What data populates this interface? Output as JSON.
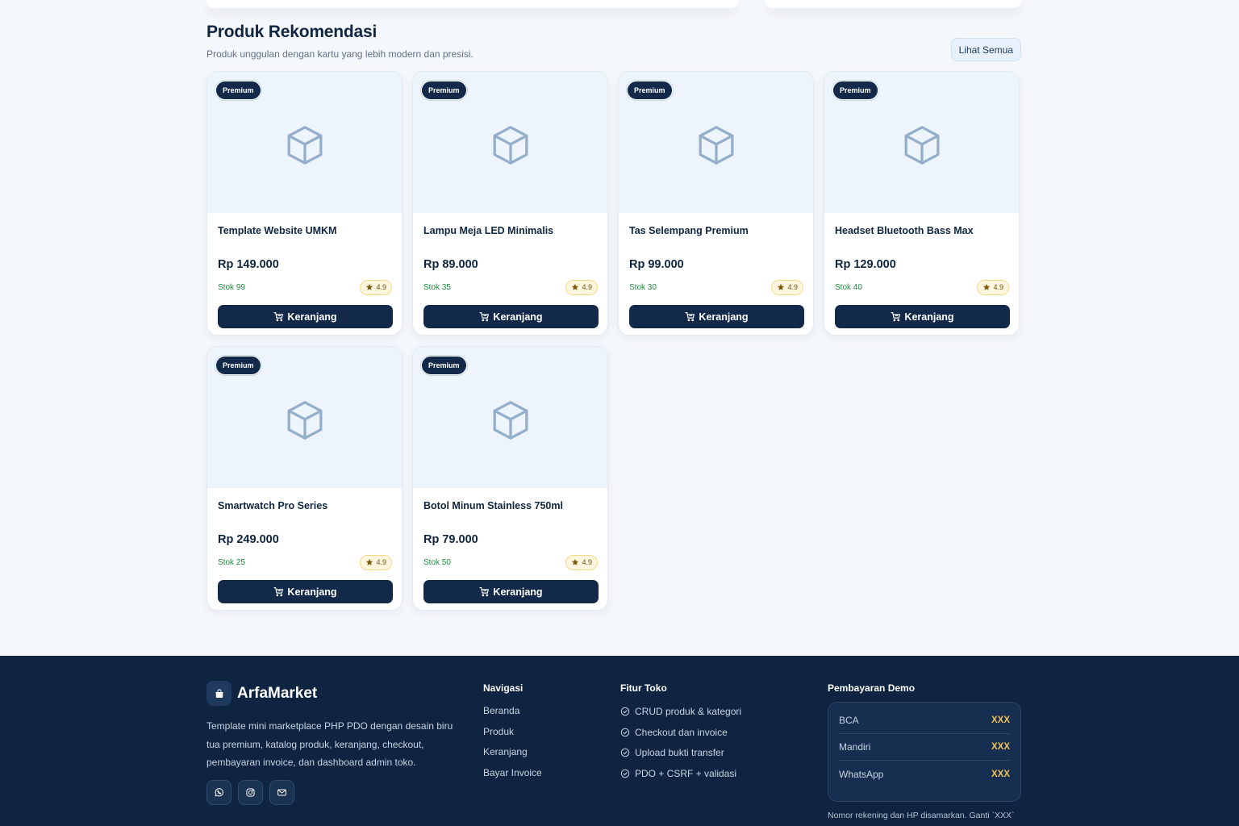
{
  "section": {
    "title": "Produk Rekomendasi",
    "subtitle": "Produk unggulan dengan kartu yang lebih modern dan presisi.",
    "see_all": "Lihat Semua"
  },
  "products": [
    {
      "badge": "Premium",
      "name": "Template Website UMKM",
      "price": "Rp 149.000",
      "stock": "Stok 99",
      "rating": "4.9",
      "button": "Keranjang"
    },
    {
      "badge": "Premium",
      "name": "Lampu Meja LED Minimalis",
      "price": "Rp 89.000",
      "stock": "Stok 35",
      "rating": "4.9",
      "button": "Keranjang"
    },
    {
      "badge": "Premium",
      "name": "Tas Selempang Premium",
      "price": "Rp 99.000",
      "stock": "Stok 30",
      "rating": "4.9",
      "button": "Keranjang"
    },
    {
      "badge": "Premium",
      "name": "Headset Bluetooth Bass Max",
      "price": "Rp 129.000",
      "stock": "Stok 40",
      "rating": "4.9",
      "button": "Keranjang"
    },
    {
      "badge": "Premium",
      "name": "Smartwatch Pro Series",
      "price": "Rp 249.000",
      "stock": "Stok 25",
      "rating": "4.9",
      "button": "Keranjang"
    },
    {
      "badge": "Premium",
      "name": "Botol Minum Stainless 750ml",
      "price": "Rp 79.000",
      "stock": "Stok 50",
      "rating": "4.9",
      "button": "Keranjang"
    }
  ],
  "footer": {
    "brand": "ArfaMarket",
    "description": "Template mini marketplace PHP PDO dengan desain biru tua premium, katalog produk, keranjang, checkout, pembayaran invoice, dan dashboard admin toko.",
    "socials": [
      "whatsapp-icon",
      "instagram-icon",
      "mail-icon"
    ],
    "nav_title": "Navigasi",
    "nav_items": [
      "Beranda",
      "Produk",
      "Keranjang",
      "Bayar Invoice"
    ],
    "features_title": "Fitur Toko",
    "features": [
      "CRUD produk & kategori",
      "Checkout dan invoice",
      "Upload bukti transfer",
      "PDO + CSRF + validasi"
    ],
    "payment_title": "Pembayaran Demo",
    "payments": [
      {
        "label": "BCA",
        "value": "XXX"
      },
      {
        "label": "Mandiri",
        "value": "XXX"
      },
      {
        "label": "WhatsApp",
        "value": "XXX"
      }
    ],
    "payment_note": "Nomor rekening dan HP disamarkan. Ganti `XXX`"
  },
  "colors": {
    "primary": "#12294a",
    "footer_bg": "#0e2440",
    "stock_green": "#1b8a3e",
    "rating_gold": "#f2c14e",
    "thumb_bg": "#eef4fb"
  }
}
